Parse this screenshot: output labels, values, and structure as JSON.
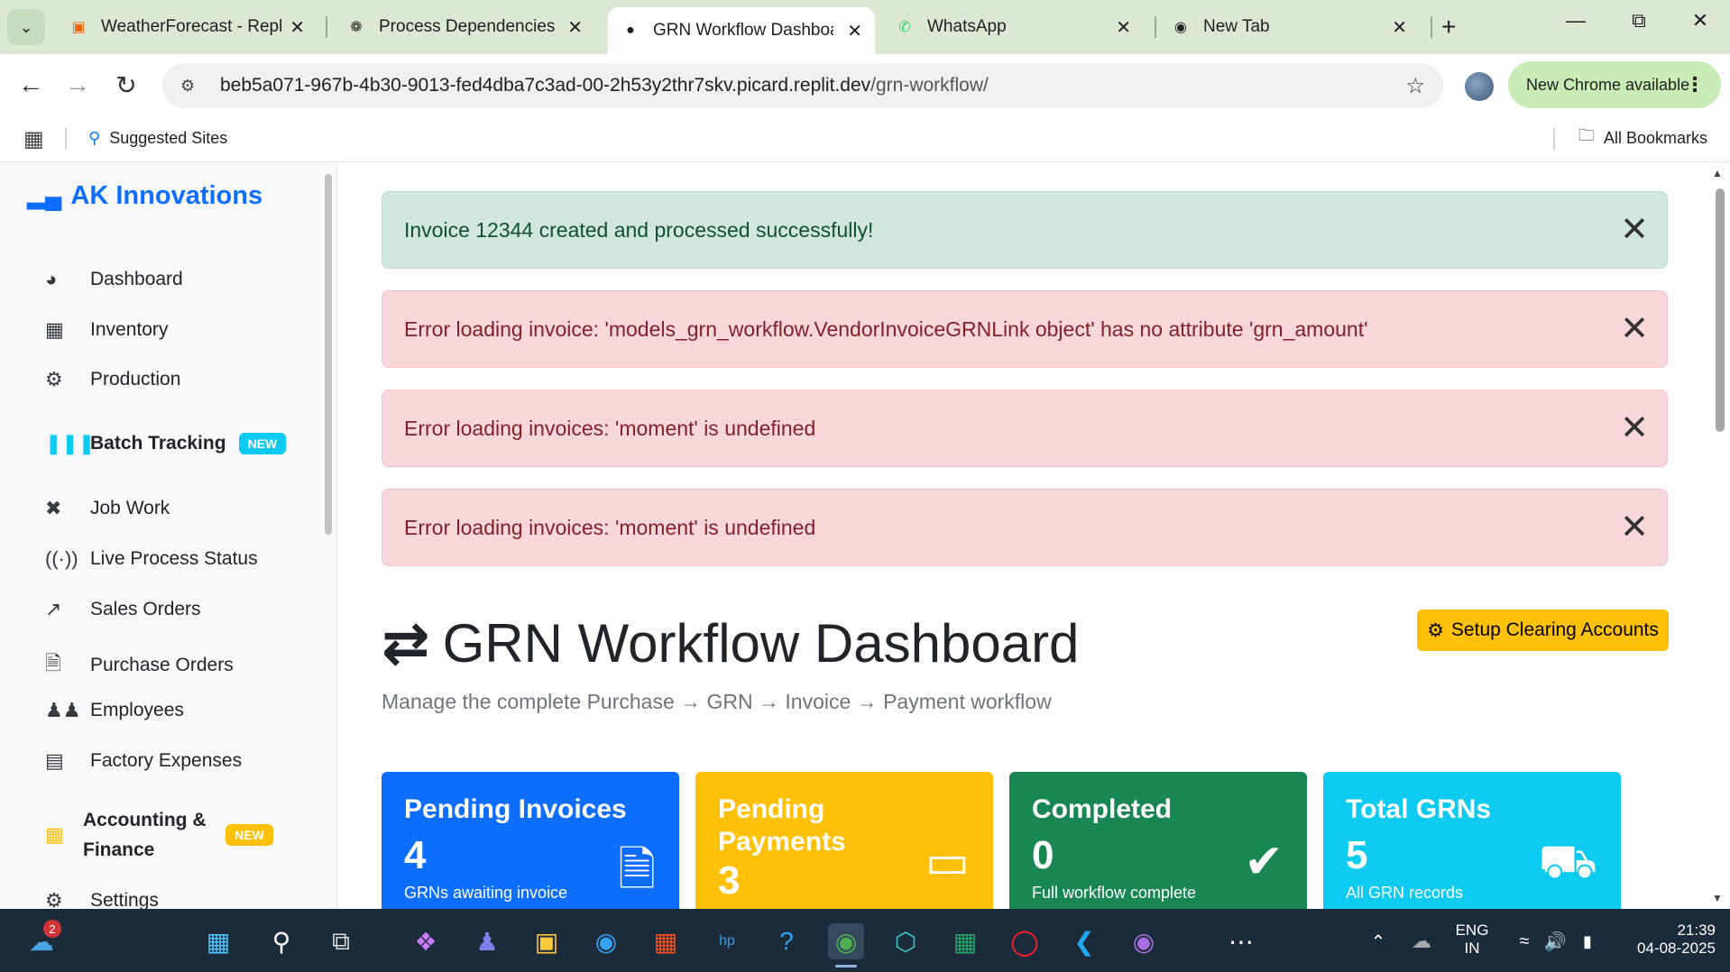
{
  "browser": {
    "tabs": [
      {
        "title": "WeatherForecast - Replit",
        "icon": "replit-icon"
      },
      {
        "title": "Process Dependencies O",
        "icon": "openai-icon"
      },
      {
        "title": "GRN Workflow Dashboar",
        "icon": "globe-icon"
      },
      {
        "title": "WhatsApp",
        "icon": "whatsapp-icon"
      },
      {
        "title": "New Tab",
        "icon": "chrome-icon"
      }
    ],
    "url_host": "beb5a071-967b-4b30-9013-fed4dba7c3ad-00-2h53y2thr7skv.picard.replit.dev",
    "url_path": "/grn-workflow/",
    "update_label": "New Chrome available",
    "bookmarks": {
      "suggested": "Suggested Sites",
      "all": "All Bookmarks"
    }
  },
  "sidebar": {
    "brand": "AK Innovations",
    "items": [
      {
        "label": "Dashboard",
        "icon": "gauge-icon"
      },
      {
        "label": "Inventory",
        "icon": "boxes-icon"
      },
      {
        "label": "Production",
        "icon": "cogs-icon"
      },
      {
        "label": "Batch Tracking",
        "icon": "barcode-icon",
        "badge": "NEW"
      },
      {
        "label": "Job Work",
        "icon": "tools-icon"
      },
      {
        "label": "Live Process Status",
        "icon": "broadcast-icon"
      },
      {
        "label": "Sales Orders",
        "icon": "chart-line-icon"
      },
      {
        "label": "Purchase Orders",
        "icon": "file-invoice-icon"
      },
      {
        "label": "Employees",
        "icon": "users-icon"
      },
      {
        "label": "Factory Expenses",
        "icon": "receipt-icon"
      },
      {
        "label": "Accounting & Finance",
        "icon": "calculator-icon",
        "badge": "NEW"
      },
      {
        "label": "Settings",
        "icon": "gear-icon"
      }
    ]
  },
  "alerts": [
    {
      "type": "success",
      "text": "Invoice 12344 created and processed successfully!"
    },
    {
      "type": "danger",
      "text": "Error loading invoice: 'models_grn_workflow.VendorInvoiceGRNLink object' has no attribute 'grn_amount'"
    },
    {
      "type": "danger",
      "text": "Error loading invoices: 'moment' is undefined"
    },
    {
      "type": "danger",
      "text": "Error loading invoices: 'moment' is undefined"
    }
  ],
  "page": {
    "title": "GRN Workflow Dashboard",
    "subtitle": "Manage the complete Purchase → GRN → Invoice → Payment workflow",
    "setup_button": "Setup Clearing Accounts"
  },
  "cards": [
    {
      "label": "Pending Invoices",
      "value": "4",
      "desc": "GRNs awaiting invoice",
      "color": "#0d6efd",
      "icon": "file-invoice-icon"
    },
    {
      "label": "Pending Payments",
      "value": "3",
      "desc": "",
      "color": "#ffc107",
      "icon": "credit-card-icon"
    },
    {
      "label": "Completed",
      "value": "0",
      "desc": "Full workflow complete",
      "color": "#198754",
      "icon": "check-circle-icon"
    },
    {
      "label": "Total GRNs",
      "value": "5",
      "desc": "All GRN records",
      "color": "#0dcaf0",
      "icon": "truck-icon"
    }
  ],
  "taskbar": {
    "notification_count": "2",
    "lang": "ENG",
    "region": "IN",
    "time": "21:39",
    "date": "04-08-2025"
  }
}
